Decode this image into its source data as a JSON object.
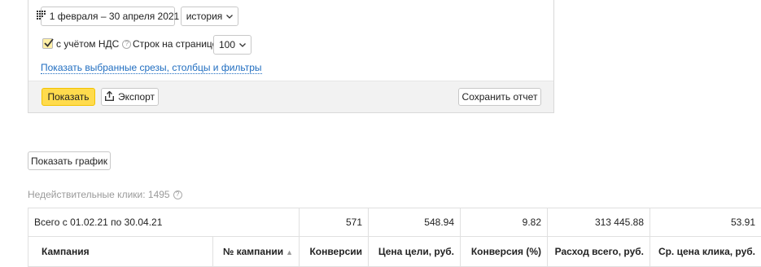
{
  "filters": {
    "date_range": "1 февраля – 30 апреля 2021",
    "history_select": "история",
    "vat_label": "с учётом НДС",
    "vat_checked": true,
    "rows_per_page_label": "Строк на странице",
    "rows_per_page_value": "100",
    "show_selected_link": "Показать выбранные срезы, столбцы и фильтры"
  },
  "actions": {
    "show_button": "Показать",
    "export_button": "Экспорт",
    "save_report_button": "Сохранить отчет",
    "show_chart_button": "Показать график"
  },
  "invalid_clicks": "Недействительные клики: 1495",
  "table": {
    "total_row": {
      "label": "Всего с 01.02.21 по 30.04.21",
      "conversions": "571",
      "goal_price": "548.94",
      "conversion_rate": "9.82",
      "total_spend": "313 445.88",
      "avg_click_price": "53.91"
    },
    "headers": {
      "campaign": "Кампания",
      "campaign_no": "№ кампании",
      "conversions": "Конверсии",
      "goal_price": "Цена цели, руб.",
      "conversion_rate": "Конверсия (%)",
      "total_spend": "Расход всего, руб.",
      "avg_click_price": "Ср. цена клика, руб."
    }
  },
  "icons": {
    "calendar": "calendar-icon",
    "export": "upload-icon",
    "help": "question-circle-icon",
    "sort": "sort-asc-icon"
  }
}
